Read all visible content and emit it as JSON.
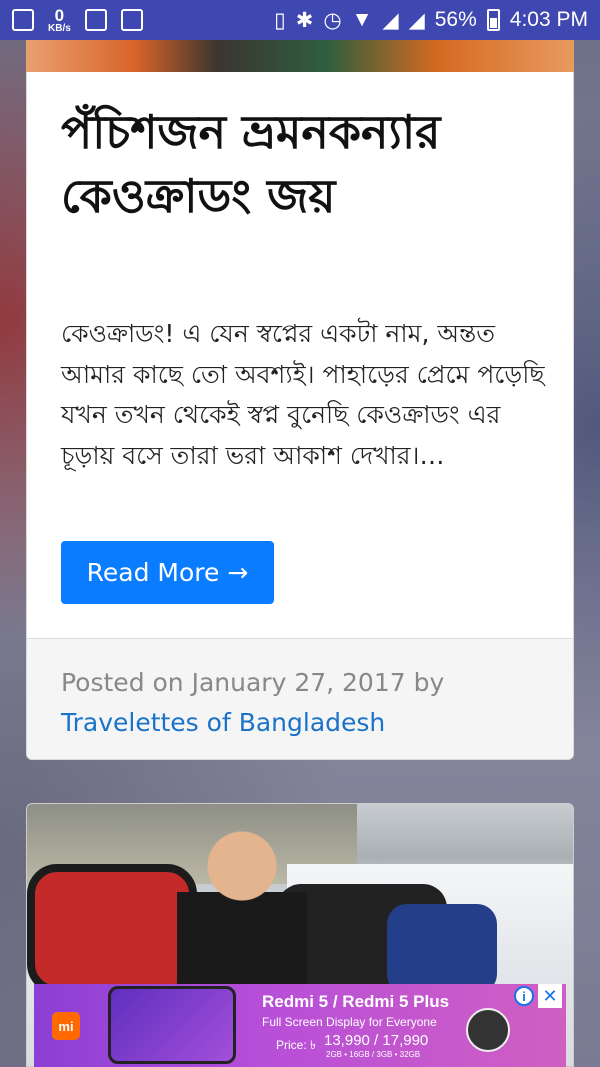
{
  "status_bar": {
    "net_speed_value": "0",
    "net_speed_unit": "KB/s",
    "battery": "56%",
    "time": "4:03 PM"
  },
  "post": {
    "title": "পঁচিশজন ভ্রমনকন্যার কেওক্রাডং জয়",
    "excerpt": "কেওক্রাডং! এ যেন স্বপ্নের একটা নাম, অন্তত আমার কাছে তো অবশ্যই। পাহাড়ের প্রেমে পড়েছি যখন তখন থেকেই স্বপ্ন বুনেছি কেওক্রাডং এর চূড়ায় বসে তারা ভরা আকাশ দেখার।…",
    "read_more": "Read More →",
    "posted_on": "Posted on January 27, 2017 by",
    "author": "Travelettes of Bangladesh"
  },
  "ad": {
    "brand": "mi",
    "headline": "Redmi 5 / Redmi 5 Plus",
    "subline": "Full Screen Display for Everyone",
    "price_label": "Price: ৳",
    "price": "13,990 / 17,990",
    "specs": "2GB • 16GB / 3GB • 32GB",
    "info_icon": "i",
    "close_icon": "✕"
  },
  "colors": {
    "status_bar": "#3f48b0",
    "button": "#0a7cff",
    "link": "#1a73c8"
  }
}
